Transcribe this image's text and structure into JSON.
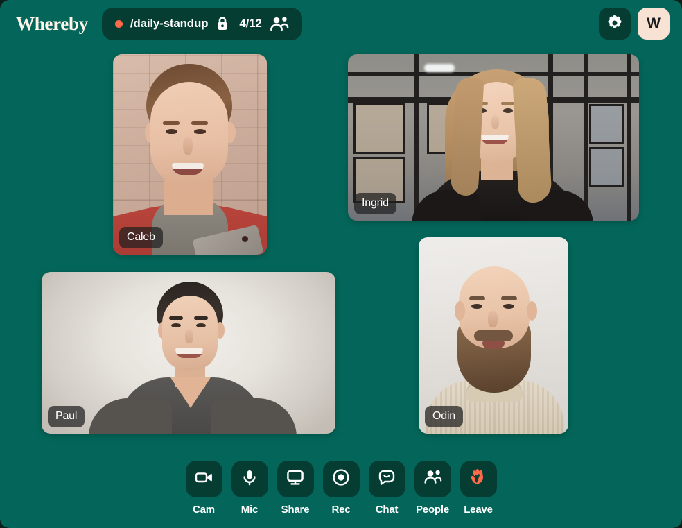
{
  "app": {
    "brand": "Whereby",
    "background_color": "#04665a",
    "panel_color": "#053d33",
    "accent_color": "#ff6b4a"
  },
  "topbar": {
    "logo": "Whereby",
    "room": {
      "recording_indicator": "recording-dot",
      "name": "/daily-standup",
      "lock_icon": "lock-icon",
      "participant_count": "4/12",
      "people_icon": "people-icon"
    },
    "settings_label": "settings-gear-icon",
    "avatar_initial": "W"
  },
  "participants": [
    {
      "name": "Caleb",
      "id": "caleb"
    },
    {
      "name": "Ingrid",
      "id": "ingrid"
    },
    {
      "name": "Paul",
      "id": "paul"
    },
    {
      "name": "Odin",
      "id": "odin"
    }
  ],
  "toolbar": {
    "items": [
      {
        "label": "Cam",
        "icon": "camera-icon"
      },
      {
        "label": "Mic",
        "icon": "microphone-icon"
      },
      {
        "label": "Share",
        "icon": "screen-share-icon"
      },
      {
        "label": "Rec",
        "icon": "record-icon"
      },
      {
        "label": "Chat",
        "icon": "chat-bubble-icon"
      },
      {
        "label": "People",
        "icon": "people-icon"
      },
      {
        "label": "Leave",
        "icon": "raised-hand-icon"
      }
    ]
  }
}
